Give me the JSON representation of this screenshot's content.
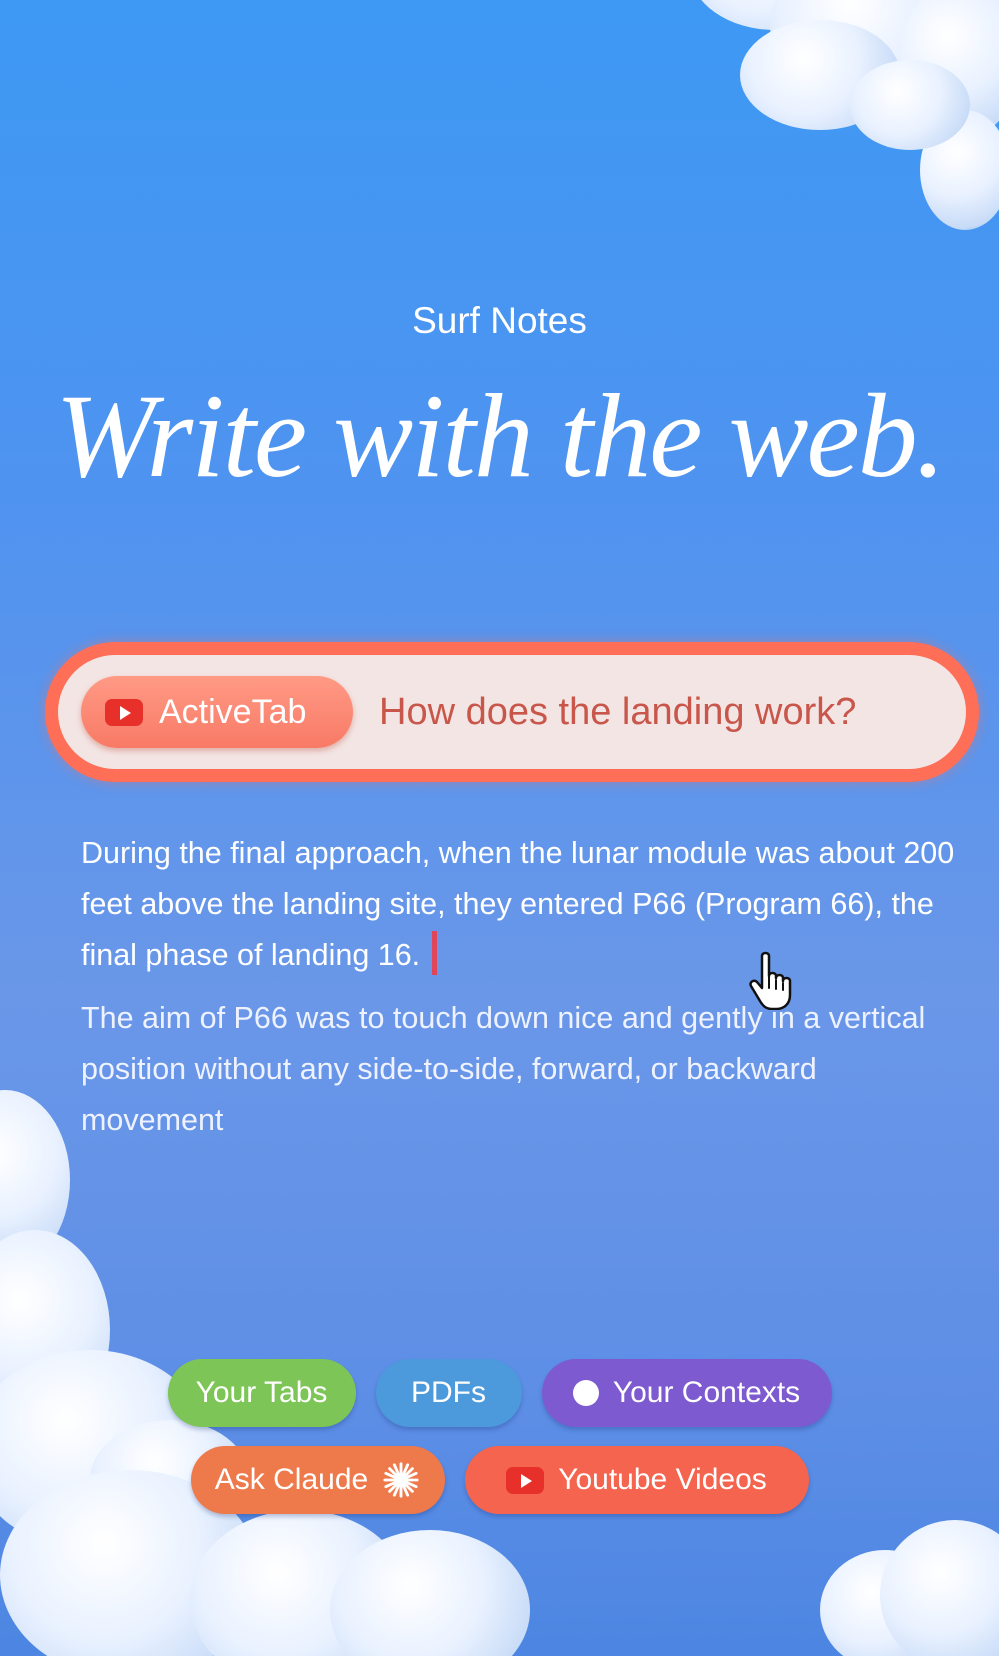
{
  "header": {
    "app_name": "Surf Notes",
    "headline": "Write with the web."
  },
  "search": {
    "context_chip_label": "ActiveTab",
    "context_chip_icon": "youtube-icon",
    "query": "How does the landing work?"
  },
  "answer": {
    "paragraphs": [
      "During the final approach, when the lunar module was about 200 feet above the landing site, they entered P66 (Program 66), the final phase of landing 16.",
      "The aim of P66 was to touch down nice and gently in a vertical position without any side-to-side, forward, or backward movement"
    ]
  },
  "sources": {
    "your_tabs": "Your Tabs",
    "pdfs": "PDFs",
    "your_contexts": "Your Contexts",
    "ask_claude": "Ask Claude",
    "youtube_videos": "Youtube Videos"
  },
  "colors": {
    "search_border": "#ff6e57",
    "your_tabs": "#7cc556",
    "pdfs": "#4c99db",
    "your_contexts": "#7e5ad0",
    "ask_claude": "#ee7a4c",
    "youtube_videos": "#f4644e"
  }
}
